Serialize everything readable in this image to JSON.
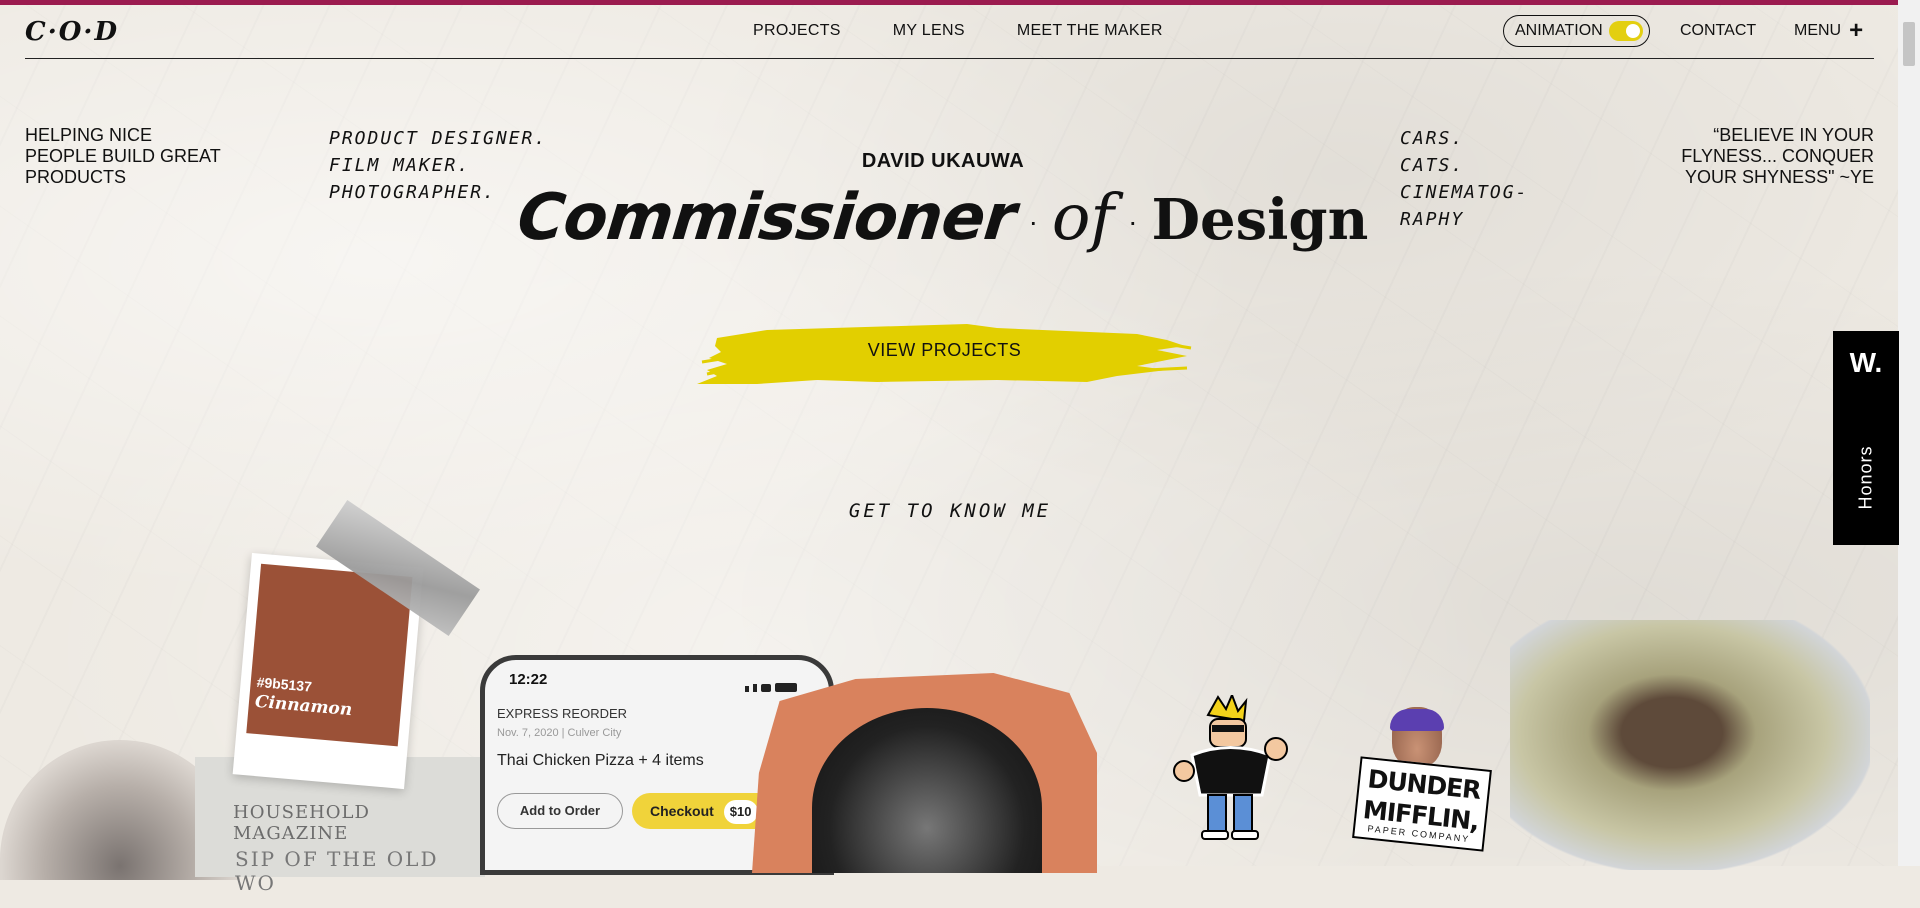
{
  "nav": {
    "logo": "C·O·D",
    "links": [
      "PROJECTS",
      "MY LENS",
      "MEET THE MAKER"
    ],
    "animation_label": "ANIMATION",
    "animation_on": true,
    "contact": "CONTACT",
    "menu": "MENU",
    "menu_icon": "+"
  },
  "hero": {
    "left_tagline": [
      "HELPING NICE",
      "PEOPLE BUILD GREAT",
      "PRODUCTS"
    ],
    "roles": [
      "PRODUCT DESIGNER.",
      "FILM MAKER.",
      "PHOTOGRAPHER."
    ],
    "name": "DAVID UKAUWA",
    "title_words": [
      "Commissioner",
      "of",
      "Design"
    ],
    "title_sep": "·",
    "interests": [
      "CARS. CATS.",
      "CINEMATOG-",
      "RAPHY"
    ],
    "quote": "“BELIEVE IN YOUR FLYNESS... CONQUER YOUR SHYNESS\" ~YE",
    "cta": "VIEW PROJECTS",
    "get_to_know": "GET TO KNOW ME"
  },
  "honors": {
    "badge": "W.",
    "label": "Honors"
  },
  "collage": {
    "swatch": {
      "hex": "#9b5137",
      "name": "Cinnamon",
      "color": "#9b5137"
    },
    "newspaper": {
      "masthead": "HOUSEHOLD MAGAZINE",
      "headline": "SIP OF THE OLD WO"
    },
    "phone": {
      "time": "12:22",
      "section": "EXPRESS REORDER",
      "date": "Nov. 7, 2020 | Culver City",
      "item": "Thai Chicken Pizza + 4 items",
      "add": "Add to Order",
      "checkout": "Checkout",
      "price": "$10"
    },
    "sticker": {
      "line1": "DUNDER",
      "line2": "MIFFLIN,",
      "line3": "PAPER COMPANY"
    }
  },
  "colors": {
    "accent_bar": "#9b1b4f",
    "cta_yellow": "#e2cf00",
    "toggle": "#e3cf10"
  }
}
